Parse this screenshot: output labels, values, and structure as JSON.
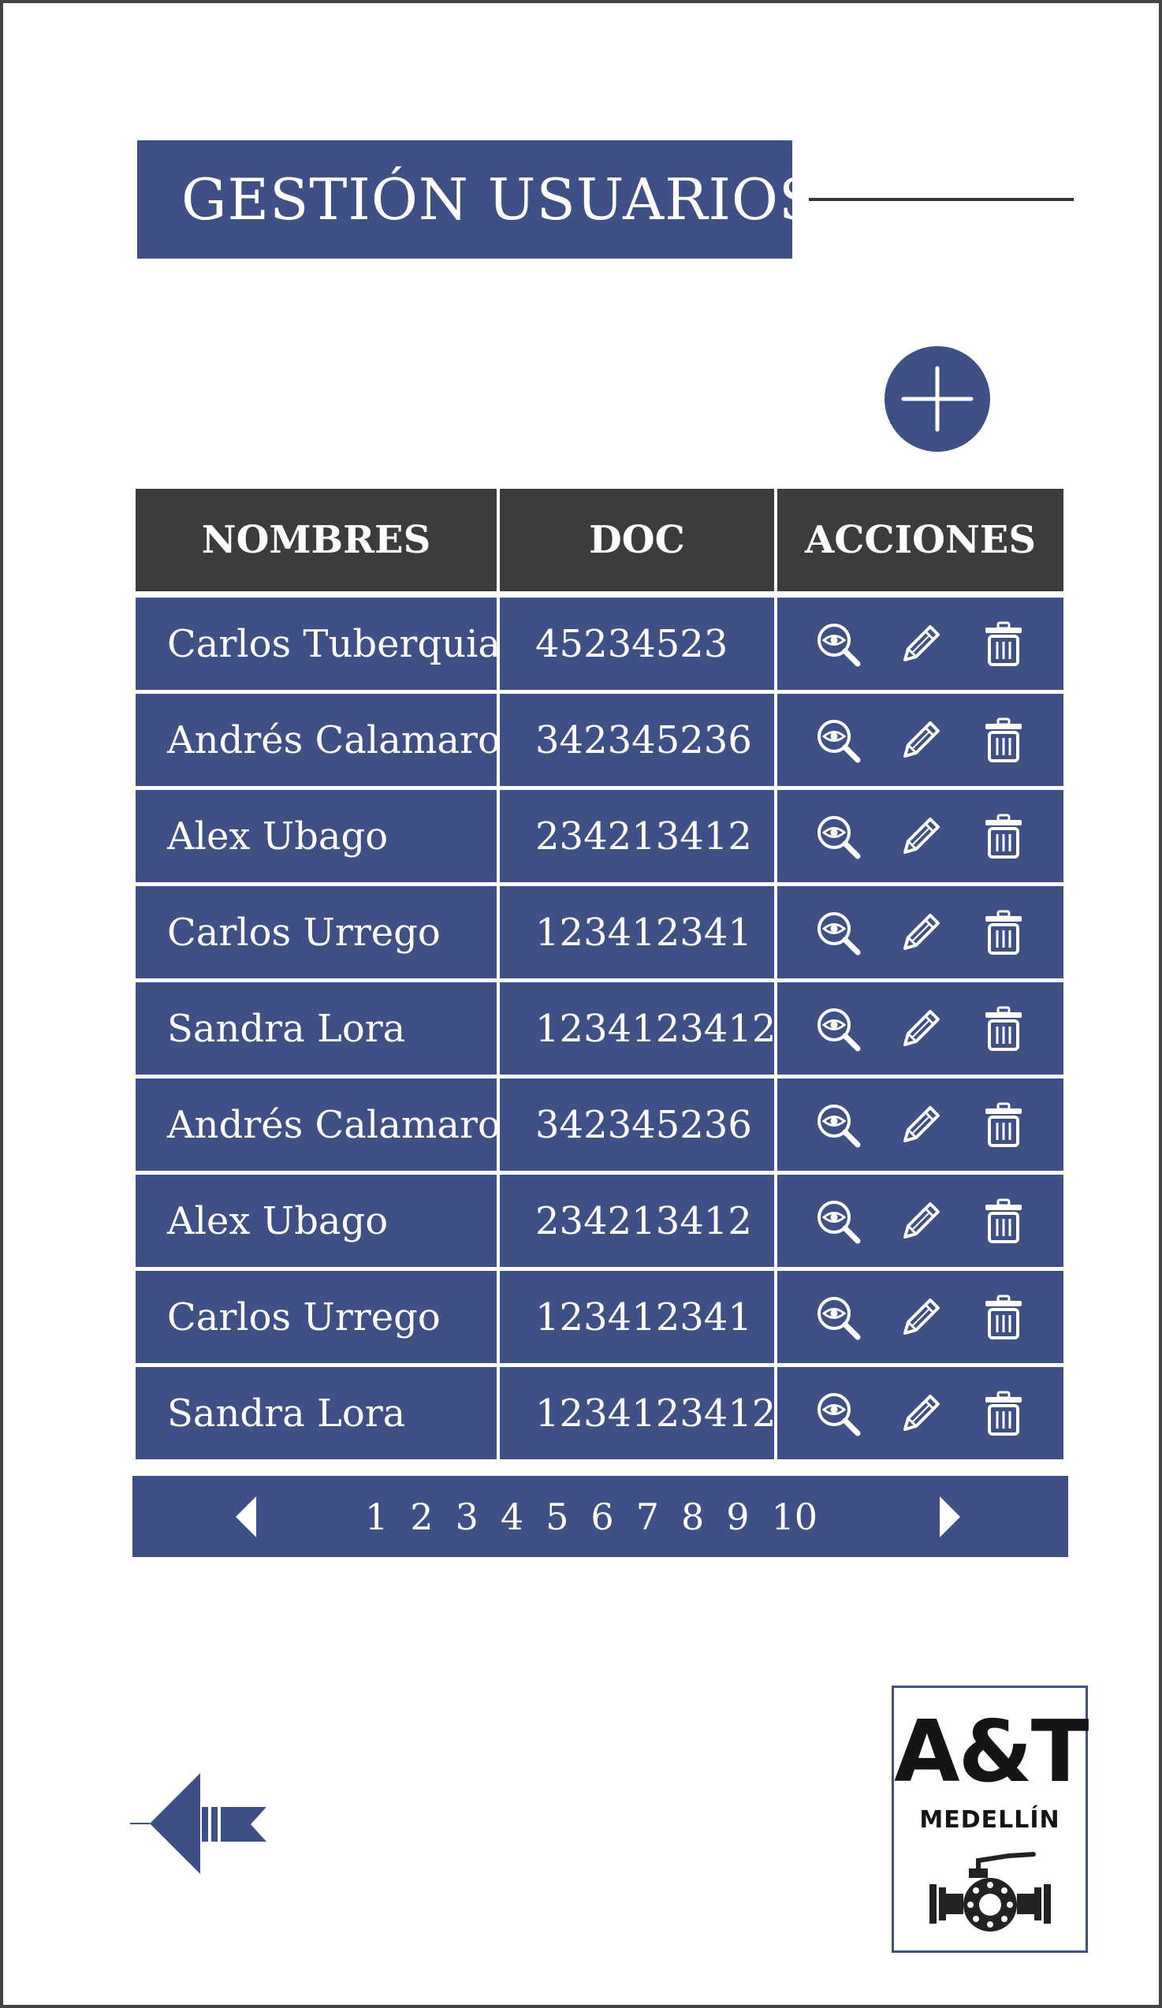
{
  "header": {
    "title": "GESTIÓN USUARIOS"
  },
  "add_button": {
    "icon": "plus-icon"
  },
  "table": {
    "columns": [
      "NOMBRES",
      "DOC",
      "ACCIONES"
    ],
    "rows": [
      {
        "name": "Carlos Tuberquia",
        "doc": "45234523"
      },
      {
        "name": "Andrés Calamaro",
        "doc": "342345236"
      },
      {
        "name": "Alex Ubago",
        "doc": "234213412"
      },
      {
        "name": "Carlos Urrego",
        "doc": "123412341"
      },
      {
        "name": "Sandra Lora",
        "doc": "1234123412"
      },
      {
        "name": "Andrés Calamaro",
        "doc": "342345236"
      },
      {
        "name": "Alex Ubago",
        "doc": "234213412"
      },
      {
        "name": "Carlos Urrego",
        "doc": "123412341"
      },
      {
        "name": "Sandra Lora",
        "doc": "1234123412"
      }
    ],
    "action_icons": [
      "view-icon",
      "edit-icon",
      "delete-icon"
    ]
  },
  "pagination": {
    "pages": [
      "1",
      "2",
      "3",
      "4",
      "5",
      "6",
      "7",
      "8",
      "9",
      "10"
    ]
  },
  "logo": {
    "main": "A&T",
    "sub": "MEDELLÍN"
  },
  "colors": {
    "primary": "#3f5086",
    "header": "#3c3c3c",
    "background": "#ffffff"
  }
}
